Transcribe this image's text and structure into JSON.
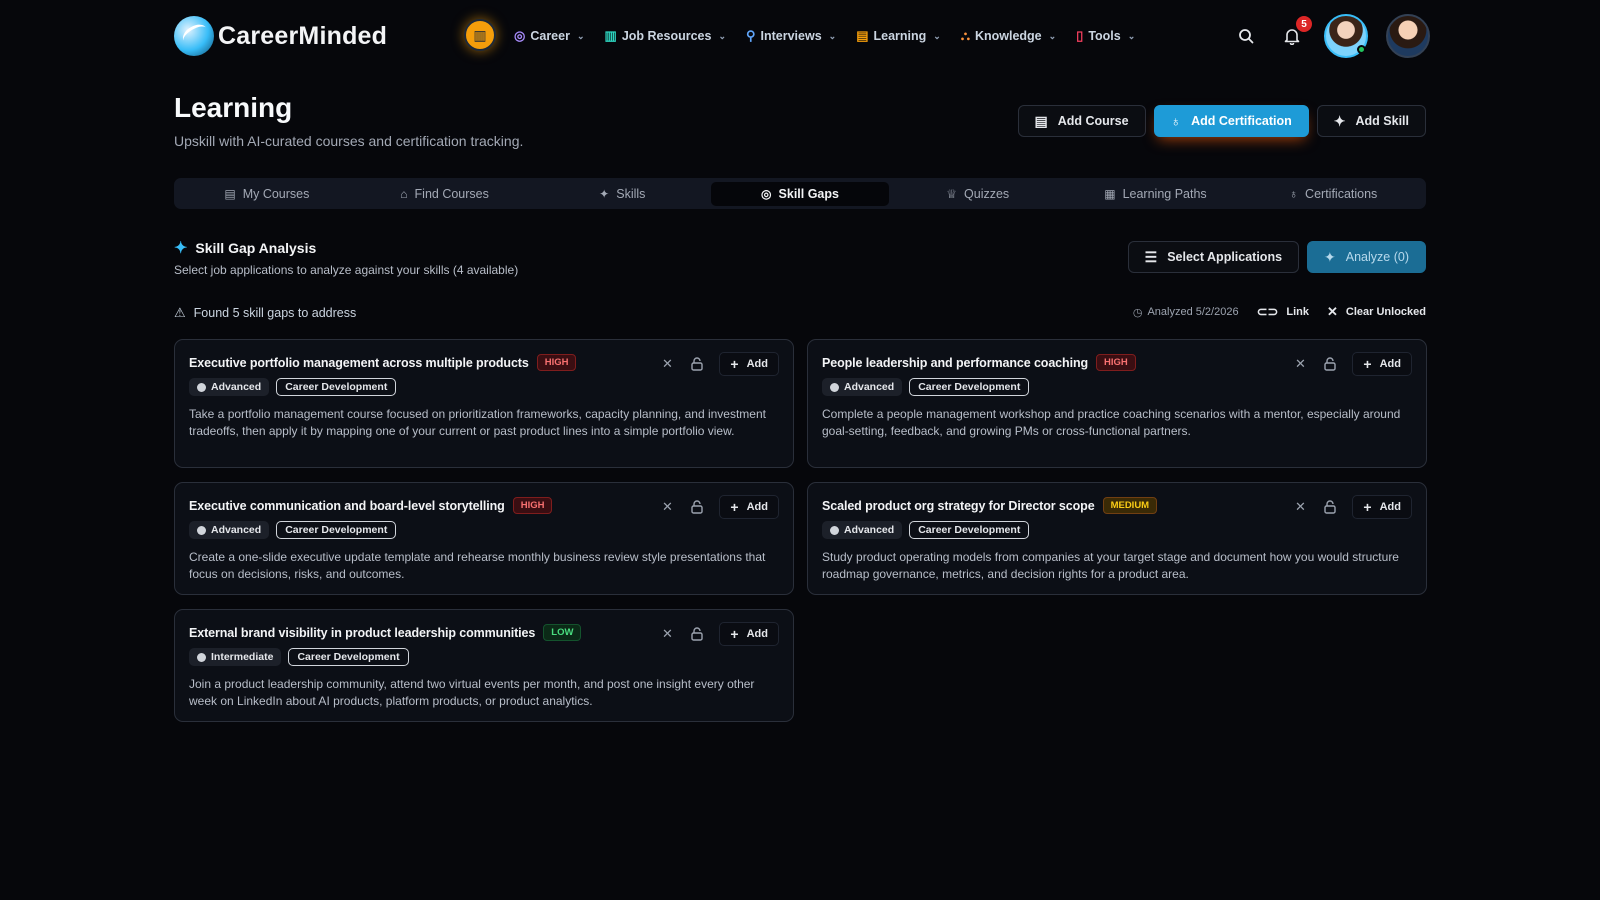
{
  "brand": {
    "name": "CareerMinded"
  },
  "nav": {
    "items": [
      {
        "label": "Career",
        "icon": "◎",
        "color": "#a78bfa"
      },
      {
        "label": "Job Resources",
        "icon": "▥",
        "color": "#2dd4bf"
      },
      {
        "label": "Interviews",
        "icon": "🎙",
        "color": "#60a5fa"
      },
      {
        "label": "Learning",
        "icon": "📖",
        "color": "#f59e0b"
      },
      {
        "label": "Knowledge",
        "icon": "⛬",
        "color": "#fb923c"
      },
      {
        "label": "Tools",
        "icon": "▯",
        "color": "#f43f5e"
      }
    ],
    "notification_count": "5"
  },
  "page": {
    "title": "Learning",
    "subtitle": "Upskill with AI-curated courses and certification tracking.",
    "actions": {
      "add_course": "Add Course",
      "add_certification": "Add Certification",
      "add_skill": "Add Skill"
    }
  },
  "tabs": [
    {
      "label": "My Courses",
      "icon": "📖"
    },
    {
      "label": "Find Courses",
      "icon": "🎓"
    },
    {
      "label": "Skills",
      "icon": "✦"
    },
    {
      "label": "Skill Gaps",
      "icon": "◎"
    },
    {
      "label": "Quizzes",
      "icon": "🏆"
    },
    {
      "label": "Learning Paths",
      "icon": "▦"
    },
    {
      "label": "Certifications",
      "icon": "♁"
    }
  ],
  "skill_gap": {
    "title": "Skill Gap Analysis",
    "subtitle": "Select job applications to analyze against your skills (4 available)",
    "select_label": "Select Applications",
    "analyze_label": "Analyze (0)",
    "found_text": "Found 5 skill gaps to address",
    "analyzed_text": "Analyzed 5/2/2026",
    "link_label": "Link",
    "clear_label": "Clear Unlocked",
    "add_label": "Add"
  },
  "cards": [
    {
      "title": "Executive portfolio management across multiple products",
      "priority": "HIGH",
      "level": "Advanced",
      "category": "Career Development",
      "description": "Take a portfolio management course focused on prioritization frameworks, capacity planning, and investment tradeoffs, then apply it by mapping one of your current or past product lines into a simple portfolio view."
    },
    {
      "title": "People leadership and performance coaching",
      "priority": "HIGH",
      "level": "Advanced",
      "category": "Career Development",
      "description": "Complete a people management workshop and practice coaching scenarios with a mentor, especially around goal-setting, feedback, and growing PMs or cross-functional partners."
    },
    {
      "title": "Executive communication and board-level storytelling",
      "priority": "HIGH",
      "level": "Advanced",
      "category": "Career Development",
      "description": "Create a one-slide executive update template and rehearse monthly business review style presentations that focus on decisions, risks, and outcomes."
    },
    {
      "title": "Scaled product org strategy for Director scope",
      "priority": "MEDIUM",
      "level": "Advanced",
      "category": "Career Development",
      "description": "Study product operating models from companies at your target stage and document how you would structure roadmap governance, metrics, and decision rights for a product area."
    },
    {
      "title": "External brand visibility in product leadership communities",
      "priority": "LOW",
      "level": "Intermediate",
      "category": "Career Development",
      "description": "Join a product leadership community, attend two virtual events per month, and post one insight every other week on LinkedIn about AI products, platform products, or product analytics."
    }
  ]
}
